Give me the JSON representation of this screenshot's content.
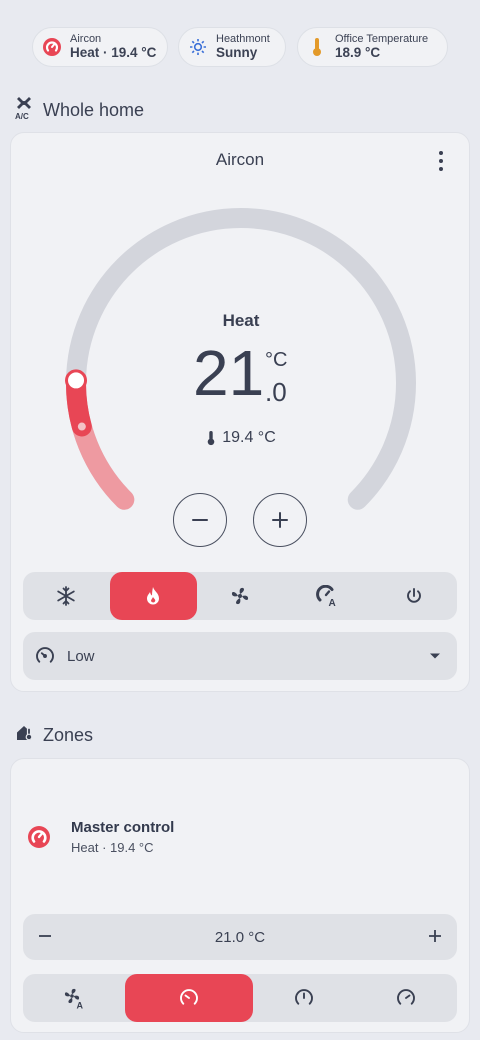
{
  "chips": [
    {
      "label": "Aircon",
      "value": "Heat · 19.4 °C",
      "icon": "heat-mode-icon"
    },
    {
      "label": "Heathmont",
      "value": "Sunny",
      "icon": "sun-icon"
    },
    {
      "label": "Office Temperature",
      "value": "18.9 °C",
      "icon": "thermometer-icon"
    }
  ],
  "section_whole_home": {
    "title": "Whole home",
    "icon": "aircon-icon"
  },
  "aircon_card": {
    "title": "Aircon",
    "mode": "Heat",
    "target_temp_int": "21",
    "target_temp_dec": ".0",
    "unit": "°C",
    "current_temp": "19.4 °C",
    "target_fraction": 0.17,
    "current_fraction": 0.05,
    "modes": [
      "cool",
      "heat",
      "fan",
      "auto",
      "off"
    ],
    "active_mode": "heat",
    "fan_speed": "Low"
  },
  "section_zones": {
    "title": "Zones",
    "icon": "home-thermometer-icon"
  },
  "zone_card": {
    "name": "Master control",
    "status": "Heat · 19.4 °C",
    "setpoint": "21.0 °C",
    "fan_modes": [
      "fan-auto",
      "low",
      "medium",
      "high"
    ],
    "active_fan_mode": "low"
  },
  "colors": {
    "accent": "#e84655",
    "accent_light": "#ee9aa1",
    "track": "#d3d5dc",
    "background": "#e8eaf0",
    "card": "#f1f2f5"
  }
}
